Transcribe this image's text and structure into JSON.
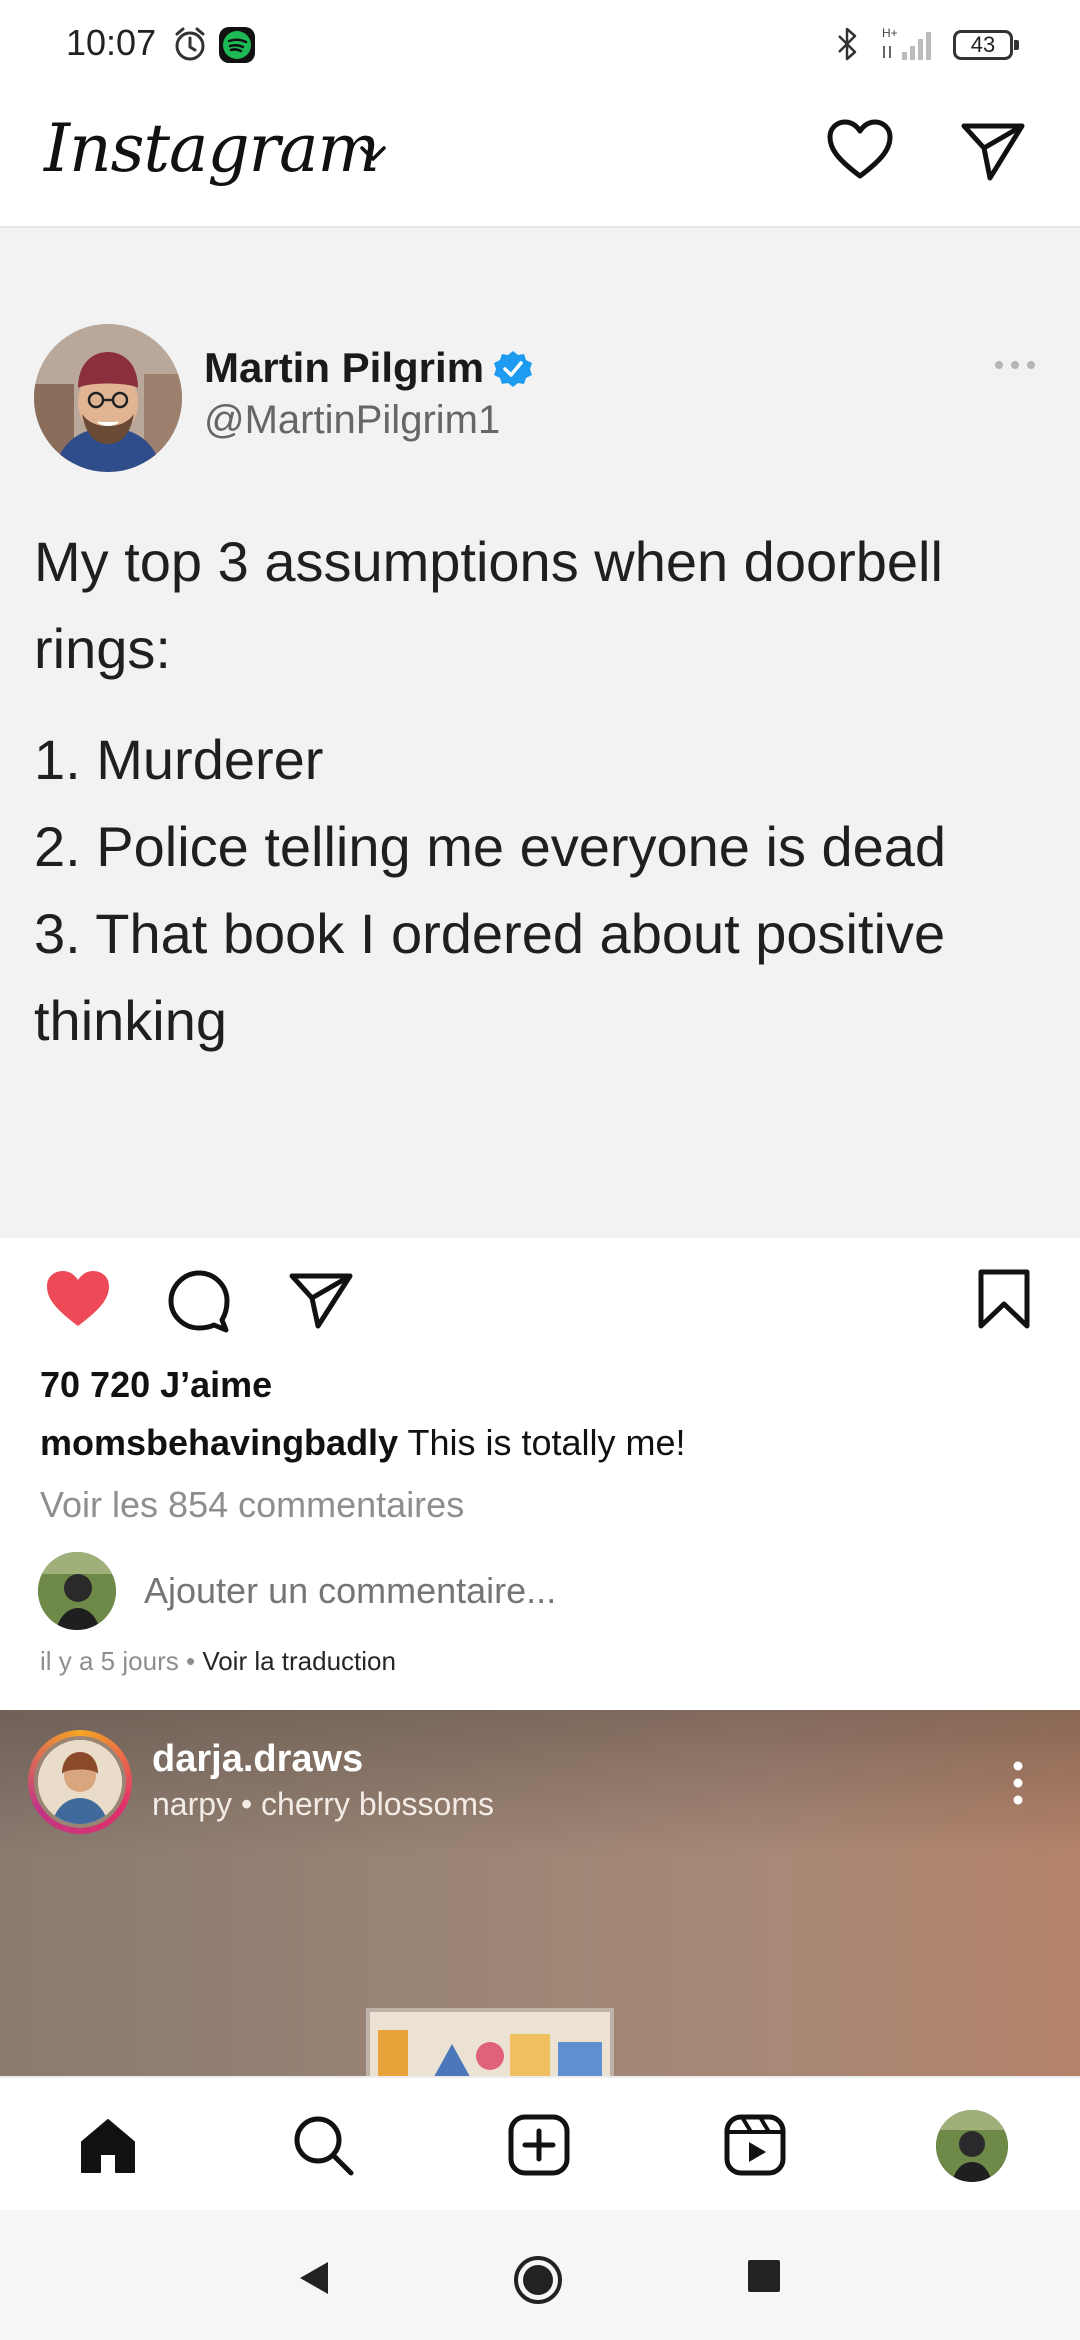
{
  "status_bar": {
    "time": "10:07",
    "battery": "43",
    "icons": [
      "alarm-icon",
      "spotify-icon",
      "bluetooth-icon",
      "signal-icon"
    ]
  },
  "header": {
    "app_name": "Instagram",
    "icons": [
      "chevron-down-icon",
      "heart-icon",
      "direct-message-icon"
    ]
  },
  "post": {
    "tweet": {
      "name": "Martin Pilgrim",
      "handle": "@MartinPilgrim1",
      "intro": "My top 3 assumptions when doorbell rings:",
      "items": [
        "1. Murderer",
        "2. Police telling me everyone is dead",
        "3. That book I ordered about positive thinking"
      ]
    },
    "liked": true,
    "likes": "70 720 J’aime",
    "caption_user": "momsbehavingbadly",
    "caption_text": "This is totally me!",
    "view_comments": "Voir les 854 commentaires",
    "comment_placeholder": "Ajouter un commentaire...",
    "time_ago": "il y a 5 jours",
    "separator": "•",
    "see_translation": "Voir la traduction"
  },
  "next_post": {
    "username": "darja.draws",
    "subtitle": "narpy • cherry blossoms"
  },
  "bottom_nav": {
    "items": [
      "home-icon",
      "search-icon",
      "new-post-icon",
      "reels-icon",
      "profile-avatar"
    ]
  },
  "colors": {
    "like_red": "#ed4956",
    "verified_blue": "#1d9bf0",
    "muted_text": "#8e8e8e"
  }
}
